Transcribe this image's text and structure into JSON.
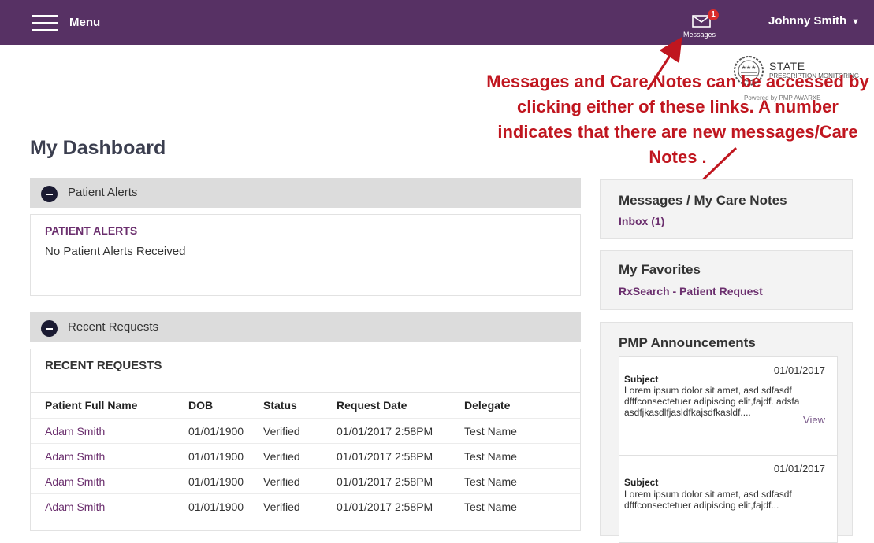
{
  "topbar": {
    "menu_label": "Menu",
    "messages_badge": "1",
    "messages_label": "Messages",
    "user_name": "Johnny Smith",
    "user_caret": "▼"
  },
  "logo": {
    "state": "STATE",
    "subtitle": "PRESCRIPTION MONITORING",
    "powered_by": "Powered by PMP AWARXE"
  },
  "annotation": {
    "text": "Messages and Care Notes can be accessed by clicking either of these links. A number indicates that there are new messages/Care Notes ."
  },
  "page": {
    "title": "My Dashboard"
  },
  "patient_alerts": {
    "header": "Patient Alerts",
    "title": "PATIENT ALERTS",
    "empty_text": "No Patient Alerts Received"
  },
  "recent_requests": {
    "header": "Recent Requests",
    "title": "RECENT REQUESTS",
    "columns": [
      "Patient Full Name",
      "DOB",
      "Status",
      "Request Date",
      "Delegate"
    ],
    "rows": [
      [
        "Adam Smith",
        "01/01/1900",
        "Verified",
        "01/01/2017 2:58PM",
        "Test Name"
      ],
      [
        "Adam Smith",
        "01/01/1900",
        "Verified",
        "01/01/2017 2:58PM",
        "Test Name"
      ],
      [
        "Adam Smith",
        "01/01/1900",
        "Verified",
        "01/01/2017 2:58PM",
        "Test Name"
      ],
      [
        "Adam Smith",
        "01/01/1900",
        "Verified",
        "01/01/2017 2:58PM",
        "Test Name"
      ]
    ]
  },
  "messages_panel": {
    "title": "Messages / My Care Notes",
    "inbox_link": "Inbox (1)"
  },
  "favorites": {
    "title": "My Favorites",
    "link": "RxSearch - Patient Request"
  },
  "announcements": {
    "title": "PMP Announcements",
    "items": [
      {
        "date": "01/01/2017",
        "subject": "Subject",
        "body": "Lorem ipsum dolor sit amet, asd sdfasdf dfffconsectetuer adipiscing elit,fajdf. adsfa asdfjkasdlfjasldfkajsdfkasldf....",
        "view": "View"
      },
      {
        "date": "01/01/2017",
        "subject": "Subject",
        "body": "Lorem ipsum dolor sit amet, asd sdfasdf dfffconsectetuer adipiscing elit,fajdf..."
      }
    ]
  },
  "colors": {
    "topbar": "#573164",
    "link_purple": "#6b2f6e",
    "annotation_red": "#c0161f",
    "badge_red": "#d92b2b"
  }
}
